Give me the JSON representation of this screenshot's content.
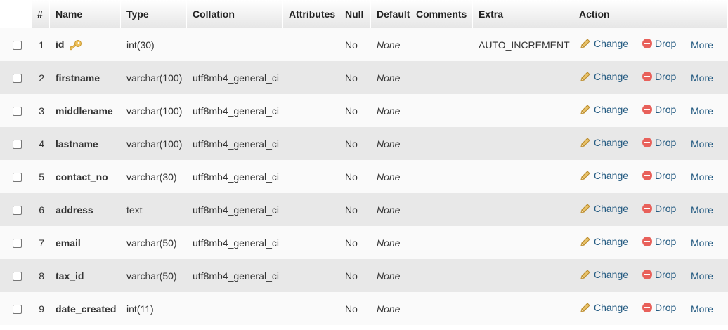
{
  "columns": {
    "num": "#",
    "name": "Name",
    "type": "Type",
    "collation": "Collation",
    "attributes": "Attributes",
    "null": "Null",
    "default": "Default",
    "comments": "Comments",
    "extra": "Extra",
    "action": "Action"
  },
  "actions": {
    "change": "Change",
    "drop": "Drop",
    "more": "More"
  },
  "rows": [
    {
      "num": "1",
      "name": "id",
      "type": "int(30)",
      "collation": "",
      "attributes": "",
      "null": "No",
      "default": "None",
      "comments": "",
      "extra": "AUTO_INCREMENT",
      "primary_key": true
    },
    {
      "num": "2",
      "name": "firstname",
      "type": "varchar(100)",
      "collation": "utf8mb4_general_ci",
      "attributes": "",
      "null": "No",
      "default": "None",
      "comments": "",
      "extra": ""
    },
    {
      "num": "3",
      "name": "middlename",
      "type": "varchar(100)",
      "collation": "utf8mb4_general_ci",
      "attributes": "",
      "null": "No",
      "default": "None",
      "comments": "",
      "extra": ""
    },
    {
      "num": "4",
      "name": "lastname",
      "type": "varchar(100)",
      "collation": "utf8mb4_general_ci",
      "attributes": "",
      "null": "No",
      "default": "None",
      "comments": "",
      "extra": ""
    },
    {
      "num": "5",
      "name": "contact_no",
      "type": "varchar(30)",
      "collation": "utf8mb4_general_ci",
      "attributes": "",
      "null": "No",
      "default": "None",
      "comments": "",
      "extra": ""
    },
    {
      "num": "6",
      "name": "address",
      "type": "text",
      "collation": "utf8mb4_general_ci",
      "attributes": "",
      "null": "No",
      "default": "None",
      "comments": "",
      "extra": ""
    },
    {
      "num": "7",
      "name": "email",
      "type": "varchar(50)",
      "collation": "utf8mb4_general_ci",
      "attributes": "",
      "null": "No",
      "default": "None",
      "comments": "",
      "extra": ""
    },
    {
      "num": "8",
      "name": "tax_id",
      "type": "varchar(50)",
      "collation": "utf8mb4_general_ci",
      "attributes": "",
      "null": "No",
      "default": "None",
      "comments": "",
      "extra": ""
    },
    {
      "num": "9",
      "name": "date_created",
      "type": "int(11)",
      "collation": "",
      "attributes": "",
      "null": "No",
      "default": "None",
      "comments": "",
      "extra": ""
    }
  ],
  "colors": {
    "link": "#235a81",
    "pencil": "#e0b24a",
    "drop_icon": "#e8605a",
    "key": "#e8b84a"
  },
  "icons": {
    "key": "key-icon",
    "change": "pencil-icon",
    "drop": "drop-circle-icon"
  }
}
